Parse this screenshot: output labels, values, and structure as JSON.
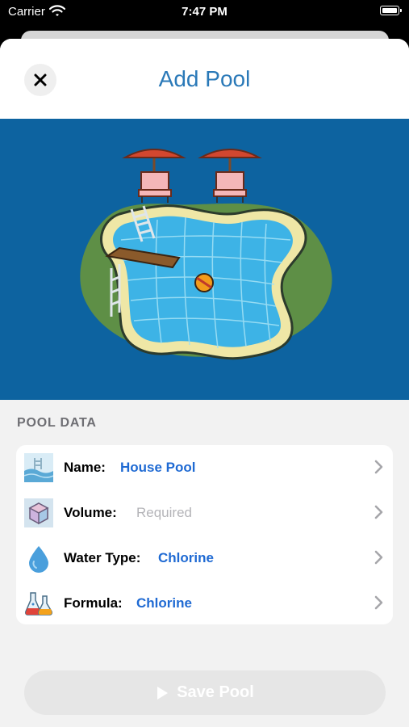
{
  "status_bar": {
    "carrier": "Carrier",
    "time": "7:47 PM"
  },
  "header": {
    "title": "Add Pool",
    "close_icon": "close-icon"
  },
  "section": {
    "title": "POOL DATA"
  },
  "rows": [
    {
      "label": "Name:",
      "value": "House Pool",
      "placeholder": false,
      "icon": "pool-icon"
    },
    {
      "label": "Volume:",
      "value": "Required",
      "placeholder": true,
      "icon": "cube-icon"
    },
    {
      "label": "Water Type:",
      "value": "Chlorine",
      "placeholder": false,
      "icon": "water-drop-icon"
    },
    {
      "label": "Formula:",
      "value": "Chlorine",
      "placeholder": false,
      "icon": "flask-icon"
    }
  ],
  "save_button": {
    "label": "Save Pool",
    "icon": "play-icon"
  },
  "colors": {
    "accent_title": "#2a79b8",
    "value_blue": "#1f6ad3",
    "illustration_bg": "#0d63a0",
    "placeholder_gray": "#b4b4b8"
  }
}
